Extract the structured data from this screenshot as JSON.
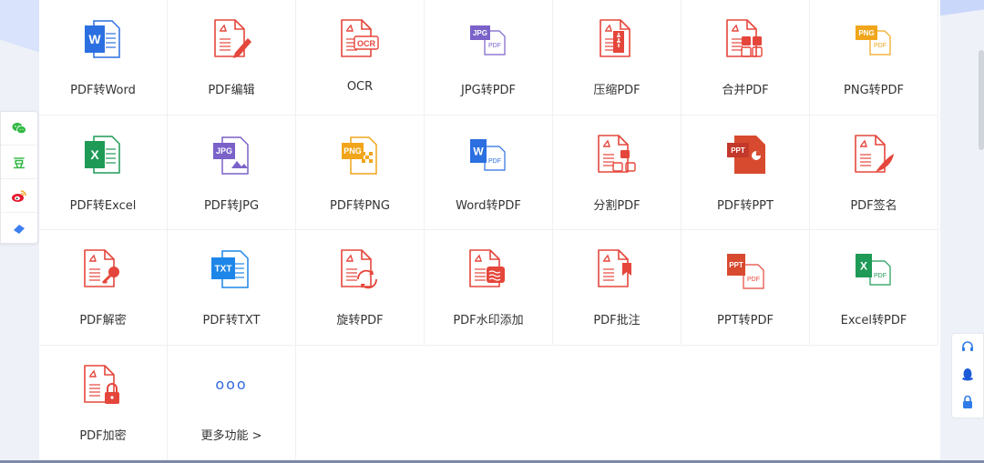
{
  "tools": [
    {
      "label": "PDF转Word",
      "icon": "pdf-to-word-icon"
    },
    {
      "label": "PDF编辑",
      "icon": "pdf-edit-icon"
    },
    {
      "label": "OCR",
      "icon": "ocr-icon"
    },
    {
      "label": "JPG转PDF",
      "icon": "jpg-to-pdf-icon"
    },
    {
      "label": "压缩PDF",
      "icon": "compress-pdf-icon"
    },
    {
      "label": "合并PDF",
      "icon": "merge-pdf-icon"
    },
    {
      "label": "PNG转PDF",
      "icon": "png-to-pdf-icon"
    },
    {
      "label": "PDF转Excel",
      "icon": "pdf-to-excel-icon"
    },
    {
      "label": "PDF转JPG",
      "icon": "pdf-to-jpg-icon"
    },
    {
      "label": "PDF转PNG",
      "icon": "pdf-to-png-icon"
    },
    {
      "label": "Word转PDF",
      "icon": "word-to-pdf-icon"
    },
    {
      "label": "分割PDF",
      "icon": "split-pdf-icon"
    },
    {
      "label": "PDF转PPT",
      "icon": "pdf-to-ppt-icon"
    },
    {
      "label": "PDF签名",
      "icon": "pdf-sign-icon"
    },
    {
      "label": "PDF解密",
      "icon": "pdf-decrypt-icon"
    },
    {
      "label": "PDF转TXT",
      "icon": "pdf-to-txt-icon"
    },
    {
      "label": "旋转PDF",
      "icon": "rotate-pdf-icon"
    },
    {
      "label": "PDF水印添加",
      "icon": "pdf-watermark-icon"
    },
    {
      "label": "PDF批注",
      "icon": "pdf-annotate-icon"
    },
    {
      "label": "PPT转PDF",
      "icon": "ppt-to-pdf-icon"
    },
    {
      "label": "Excel转PDF",
      "icon": "excel-to-pdf-icon"
    },
    {
      "label": "PDF加密",
      "icon": "pdf-encrypt-icon"
    },
    {
      "label": "更多功能 >",
      "icon": "more-icon",
      "more_dots": "ooo"
    }
  ],
  "icon_text": {
    "word": "W",
    "excel": "X",
    "jpg": "JPG",
    "png": "PNG",
    "ppt": "PPT",
    "txt": "TXT",
    "pdf": "PDF",
    "ocr": "OCR"
  },
  "share": {
    "douban": "豆"
  },
  "colors": {
    "red": "#e5463b",
    "word_blue": "#2b6fe0",
    "excel_green": "#1f9a56",
    "jpg_purple": "#7b62c9",
    "png_orange": "#f1a51b",
    "ppt_red": "#d84a2f",
    "txt_blue": "#1d86e8",
    "wechat": "#31b943",
    "weibo": "#e6162d"
  }
}
